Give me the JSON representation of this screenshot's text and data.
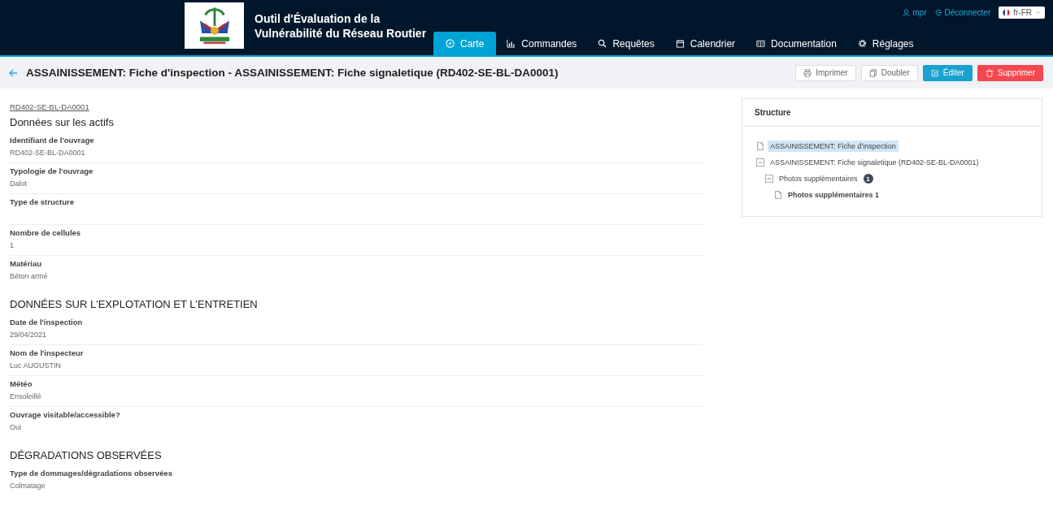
{
  "header": {
    "app_title": [
      "Outil d'Évaluation de la",
      "Vulnérabilité du Réseau Routier"
    ],
    "nav": [
      {
        "label": "Carte",
        "selected": true
      },
      {
        "label": "Commandes",
        "selected": false
      },
      {
        "label": "Requêtes",
        "selected": false
      },
      {
        "label": "Calendrier",
        "selected": false
      },
      {
        "label": "Documentation",
        "selected": false
      },
      {
        "label": "Réglages",
        "selected": false
      }
    ],
    "user": "mpr",
    "logout": "Déconnecter",
    "language": "fr-FR"
  },
  "page_header": {
    "title": "ASSAINISSEMENT: Fiche d'inspection - ASSAINISSEMENT: Fiche signaletique (RD402-SE-BL-DA0001)",
    "actions": [
      {
        "label": "Imprimer",
        "kind": "default"
      },
      {
        "label": "Doubler",
        "kind": "default"
      },
      {
        "label": "Éditer",
        "kind": "primary"
      },
      {
        "label": "Supprimer",
        "kind": "danger"
      }
    ]
  },
  "breadcrumb_link": "RD402-SE-BL-DA0001",
  "sections": [
    {
      "title": "Données sur les actifs",
      "fields": [
        {
          "label": "Identifiant de l'ouvrage",
          "value": "RD402-SE-BL-DA0001"
        },
        {
          "label": "Typologie de l'ouvrage",
          "value": "Dalot"
        },
        {
          "label": "Type de structure"
        },
        {
          "label": "Nombre de cellules",
          "value": "1"
        },
        {
          "label": "Matériau",
          "value": "Béton armé"
        }
      ]
    },
    {
      "title": "DONNÉES SUR L'EXPLOTATION ET L'ENTRETIEN",
      "fields": [
        {
          "label": "Date de l'inspection",
          "value": "29/04/2021"
        },
        {
          "label": "Nom de l'inspecteur",
          "value": "Luc AUGUSTIN"
        },
        {
          "label": "Météo",
          "value": "Ensoleillé"
        },
        {
          "label": "Ouvrage visitable/accessible?",
          "value": "Oui"
        }
      ]
    },
    {
      "title": "DÉGRADATIONS OBSERVÉES",
      "fields": [
        {
          "label": "Type de dommages/dégradations observées",
          "value": "Colmatage"
        }
      ]
    }
  ],
  "structure": {
    "title": "Structure",
    "tree": [
      {
        "label": "ASSAINISSEMENT: Fiche d'inspection",
        "kind": "leaf",
        "selected": true
      },
      {
        "label": "ASSAINISSEMENT: Fiche signaletique (RD402-SE-BL-DA0001)",
        "kind": "folder",
        "expanded": true,
        "selected": false,
        "children": [
          {
            "label": "Photos supplémentaires",
            "kind": "folder",
            "expanded": true,
            "selected": false,
            "badge": "1",
            "children": [
              {
                "label": "Photos supplémentaires 1",
                "kind": "leaf",
                "selected": false
              }
            ]
          }
        ]
      }
    ]
  }
}
